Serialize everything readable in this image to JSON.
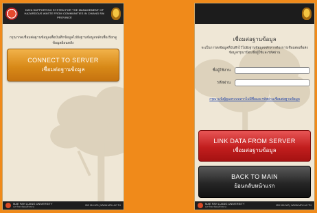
{
  "left_screen": {
    "header_text": "DATA SUPPORTING SYSTEM FOR THE MANAGEMENT OF HAZARDOUS WASTE FROM COMMUNITIES IN CHIANG RAI PROVINCE",
    "prompt": "กรุณากดเชื่อมต่อฐานข้อมูลเพื่อบันทึกข้อมูลไปยังฐานข้อมูลหลักเพื่อเรียกดูข้อมูลย้อนหลัง",
    "connect_button": {
      "label_en": "CONNECT TO SERVER",
      "label_th": "เชื่อมต่อฐานข้อมูล"
    }
  },
  "right_screen": {
    "title": "เชื่อมต่อฐานข้อมูล",
    "description": "จะเป็นการส่งข้อมูลที่บันทึกไว้ไปยังฐานข้อมูลหลักหากต้องการเชื่อมต่อเพื่อส่งข้อมูลกรุณาป้อนชื่อผู้ใช้และรหัสผ่าน",
    "username_label": "ชื่อผู้ใช้งาน",
    "password_label": "รหัสผ่าน",
    "username_value": "",
    "password_value": "",
    "forgot_text": "กรุณาแจ้งผู้ดูแลระบบหากไม่มีชื่อและรหัสผ่านเชื่อมต่อฐานข้อมูล",
    "link_button": {
      "label_en": "LINK DATA FROM SERVER",
      "label_th": "เชื่อมต่อฐานข้อมูล"
    },
    "back_button": {
      "label_en": "BACK TO MAIN",
      "label_th": "ย้อนกลับหน้าแรก"
    }
  },
  "footer": {
    "university": "MAE FAH LUANG UNIVERSITY",
    "university_sub": "มหาวิทยาลัยแม่ฟ้าหลวง",
    "contact": "053 916 000 | WWW.MFU.AC.TH"
  }
}
